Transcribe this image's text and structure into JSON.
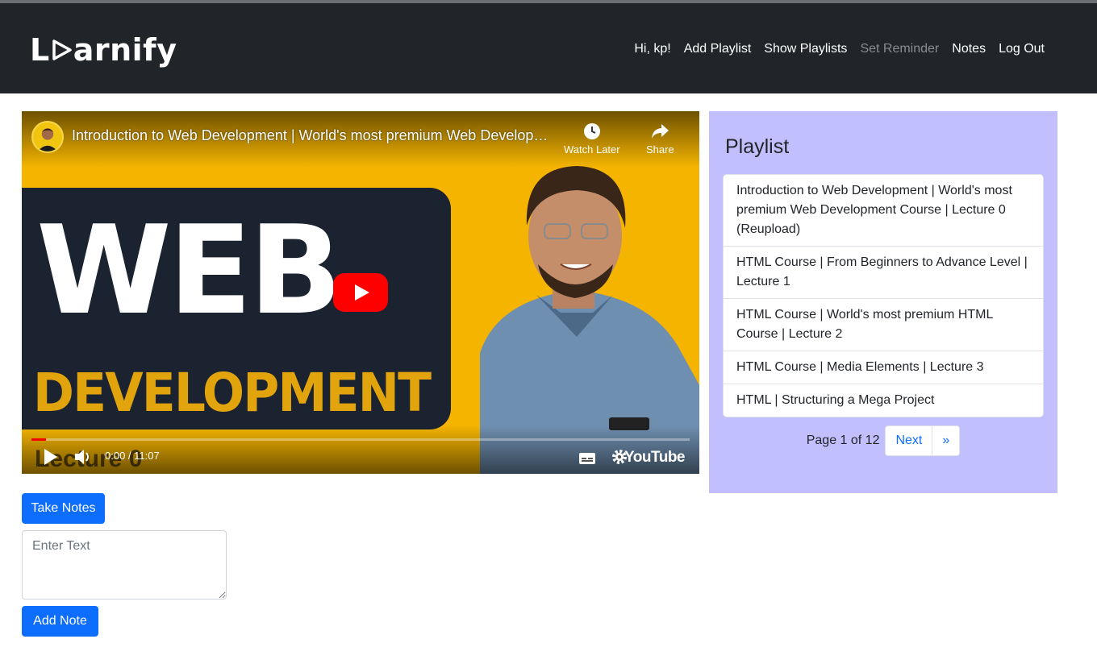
{
  "brand": {
    "name_start": "L",
    "name_end": "arnify"
  },
  "nav": {
    "greeting": "Hi, kp!",
    "add_playlist": "Add Playlist",
    "show_playlists": "Show Playlists",
    "set_reminder": "Set Reminder",
    "notes": "Notes",
    "logout": "Log Out"
  },
  "video": {
    "title": "Introduction to Web Development | World's most premium Web Developm...",
    "thumbnail_heading": "WEB",
    "thumbnail_subheading": "DEVELOPMENT",
    "thumbnail_footer": "Lecture 0",
    "watch_later": "Watch Later",
    "share": "Share",
    "time": "0:00 / 11:07",
    "youtube": "YouTube",
    "colors": {
      "thumb_bg": "#f4b400",
      "panel": "#1b2230",
      "play": "#ff0000"
    }
  },
  "notes": {
    "take_notes": "Take Notes",
    "placeholder": "Enter Text",
    "add_note": "Add Note"
  },
  "playlist": {
    "heading": "Playlist",
    "items": [
      "Introduction to Web Development | World's most premium Web Development Course | Lecture 0 (Reupload)",
      "HTML Course | From Beginners to Advance Level | Lecture 1",
      "HTML Course | World's most premium HTML Course | Lecture 2",
      "HTML Course | Media Elements | Lecture 3",
      "HTML | Structuring a Mega Project"
    ],
    "page_info": "Page 1 of 12",
    "next": "Next",
    "last": "»",
    "colors": {
      "panel": "#c1bffe",
      "link": "#0d6efd"
    }
  }
}
